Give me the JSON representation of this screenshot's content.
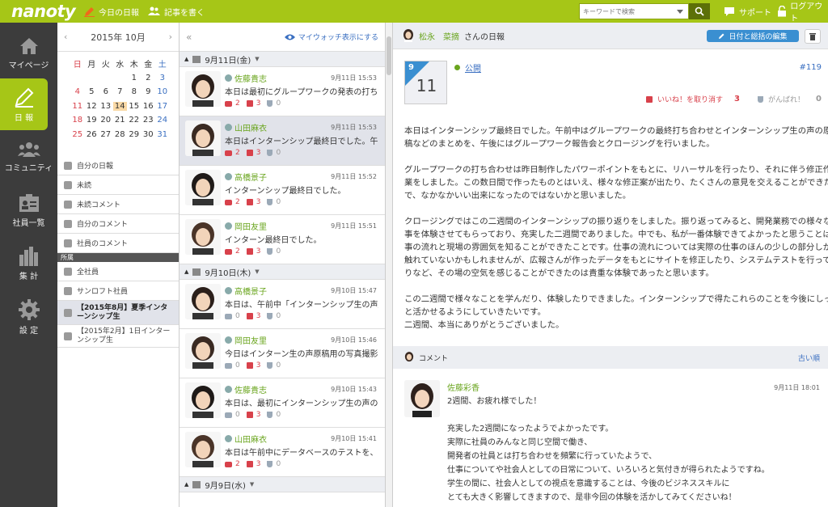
{
  "app": {
    "logo": "nanoty"
  },
  "topbar": {
    "today_diary": "今日の日報",
    "write_article": "記事を書く",
    "search_placeholder": "キーワードで検索",
    "support": "サポート",
    "logout": "ログアウト"
  },
  "leftnav": [
    {
      "label": "マイページ",
      "icon": "home-icon"
    },
    {
      "label": "日 報",
      "icon": "pencil-icon",
      "active": true
    },
    {
      "label": "コミュニティ",
      "icon": "people-icon"
    },
    {
      "label": "社員一覧",
      "icon": "id-card-icon"
    },
    {
      "label": "集 計",
      "icon": "bar-chart-icon"
    },
    {
      "label": "設 定",
      "icon": "gear-icon"
    }
  ],
  "calendar": {
    "month_label": "2015年 10月",
    "weekdays": [
      "日",
      "月",
      "火",
      "水",
      "木",
      "金",
      "土"
    ],
    "weeks": [
      [
        "",
        "",
        "",
        "",
        "1",
        "2",
        "3"
      ],
      [
        "4",
        "5",
        "6",
        "7",
        "8",
        "9",
        "10"
      ],
      [
        "11",
        "12",
        "13",
        "14",
        "15",
        "16",
        "17"
      ],
      [
        "18",
        "19",
        "20",
        "21",
        "22",
        "23",
        "24"
      ],
      [
        "25",
        "26",
        "27",
        "28",
        "29",
        "30",
        "31"
      ]
    ],
    "today": "14"
  },
  "menu": {
    "items": [
      "自分の日報",
      "未読",
      "未読コメント",
      "自分のコメント",
      "社員のコメント"
    ],
    "section": "所属",
    "groups": [
      "全社員",
      "サンロフト社員",
      "【2015年8月】夏季インターンシップ生",
      "【2015年2月】1日インターンシップ生"
    ]
  },
  "list": {
    "collapse": "«",
    "watch_label": "マイウォッチ表示にする",
    "groups": [
      {
        "date": "9月11日(金)",
        "entries": [
          {
            "name": "佐藤貴志",
            "time": "9月11日 15:53",
            "text": "本日は最初にグループワークの発表の打ち合",
            "comments": "2",
            "likes": "3",
            "cheers": "0"
          },
          {
            "name": "山田麻衣",
            "time": "9月11日 15:53",
            "text": "本日はインターンシップ最終日でした。午前中は",
            "comments": "2",
            "likes": "3",
            "cheers": "0"
          },
          {
            "name": "高橋景子",
            "time": "9月11日 15:52",
            "text": "インターンシップ最終日でした。",
            "comments": "2",
            "likes": "3",
            "cheers": "0"
          },
          {
            "name": "岡田友里",
            "time": "9月11日 15:51",
            "text": "インターン最終日でした。",
            "comments": "2",
            "likes": "3",
            "cheers": "0"
          }
        ]
      },
      {
        "date": "9月10日(木)",
        "entries": [
          {
            "name": "高橋景子",
            "time": "9月10日 15:47",
            "text": "本日は、午前中「インターンシップ生の声」の原",
            "comments": "0",
            "likes": "3",
            "cheers": "0"
          },
          {
            "name": "岡田友里",
            "time": "9月10日 15:46",
            "text": "今日はインターン生の声原稿用の写真撮影し",
            "comments": "0",
            "likes": "3",
            "cheers": "0"
          },
          {
            "name": "佐藤貴志",
            "time": "9月10日 15:43",
            "text": "本日は、最初にインターンシップ生の声のため",
            "comments": "0",
            "likes": "3",
            "cheers": "0"
          },
          {
            "name": "山田麻衣",
            "time": "9月10日 15:41",
            "text": "本日は午前中にデータベースのテストを、午後",
            "comments": "2",
            "likes": "3",
            "cheers": "0"
          }
        ]
      },
      {
        "date": "9月9日(水)",
        "entries": []
      }
    ]
  },
  "detail": {
    "author": "松永　菜摘",
    "author_suffix": "さんの日報",
    "edit_label": "日付と総括の編集",
    "month": "9",
    "day": "11",
    "visibility": "公開",
    "number": "#119",
    "like_label": "いいね！を取り消す",
    "like_count": "3",
    "cheer_label": "がんばれ！",
    "cheer_count": "0",
    "paragraphs": [
      [
        "本日はインターンシップ最終日でした。午前中はグループワークの最終打ち合わせとインターンシップ生の声の原",
        "稿などのまとめを、午後にはグループワーク報告会とクロージングを行いました。"
      ],
      [
        "グループワークの打ち合わせは昨日制作したパワーポイントをもとに、リハーサルを行ったり、それに伴う修正作",
        "業をしました。この数日間で作ったものとはいえ、様々な修正案が出たり、たくさんの意見を交えることができたの",
        "で、なかなかいい出来になったのではないかと思いました。"
      ],
      [
        "クロージングではこの二週間のインターンシップの振り返りをしました。振り返ってみると、開発業務での様々な仕",
        "事を体験させてもらっており、充実した二週間でありました。中でも、私が一番体験できてよかったと思うことは、仕",
        "事の流れと現場の雰囲気を知ることができたことです。仕事の流れについては実際の仕事のほんの少しの部分しか",
        "触れていないかもしれませんが、広報さんが作ったデータをもとにサイトを修正したり、システムテストを行ってみた",
        "りなど、その場の空気を感じることができたのは貴重な体験であったと思います。"
      ],
      [
        "この二週間で様々なことを学んだり、体験したりできました。インターンシップで得たこれらのことを今後にしっかり",
        "と活かせるようにしていきたいです。",
        "二週間、本当にありがとうございました。"
      ]
    ],
    "comment_header": "コメント",
    "sort_label": "古い順",
    "comment": {
      "name": "佐藤彩香",
      "time": "9月11日 18:01",
      "lines": [
        "2週間、お疲れ様でした！",
        "",
        "充実した2週間になったようでよかったです。",
        "実際に社員のみんなと同じ空間で働き、",
        "開発者の社員とは打ち合わせを頻繁に行っていたようで、",
        "仕事についてや社会人としての日常について、いろいろと気付きが得られたようですね。",
        "学生の間に、社会人としての視点を意識することは、今後のビジネススキルに",
        "とても大きく影響してきますので、是非今回の体験を活かしてみてくださいね！"
      ]
    }
  },
  "colors": {
    "accent": "#a6c617",
    "nav_bg": "#3c3c3c",
    "link": "#3a6fc1",
    "like": "#d8414b",
    "name": "#6aa51e"
  }
}
